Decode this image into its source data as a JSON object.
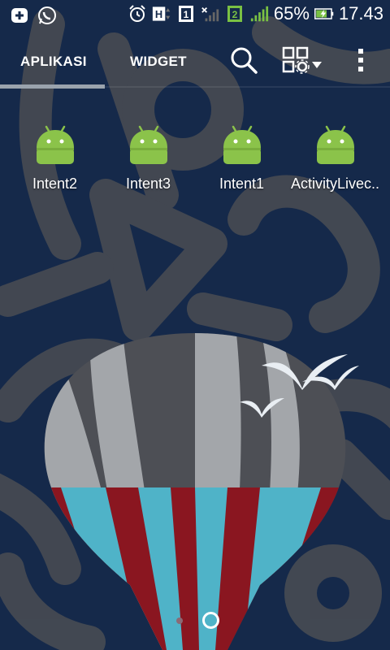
{
  "status_bar": {
    "battery_percent": "65%",
    "time": "17.43",
    "icons": [
      "add-notification-icon",
      "whatsapp-icon",
      "alarm-icon",
      "network-h-icon",
      "sim1-icon",
      "signal-weak-icon",
      "sim2-icon",
      "signal-strong-icon",
      "battery-charging-icon"
    ]
  },
  "tabs": {
    "apps_label": "APLIKASI",
    "widget_label": "WIDGET",
    "selected": "APLIKASI"
  },
  "toolbar": {
    "icons": [
      "search-icon",
      "grid-settings-icon",
      "overflow-menu-icon"
    ]
  },
  "apps": [
    {
      "label": "Intent2",
      "icon": "android-icon"
    },
    {
      "label": "Intent3",
      "icon": "android-icon"
    },
    {
      "label": "Intent1",
      "icon": "android-icon"
    },
    {
      "label": "ActivityLivec..",
      "icon": "android-icon"
    }
  ],
  "page_indicator": {
    "pages": 2,
    "current": "home"
  },
  "colors": {
    "background": "#15294a",
    "android_green": "#8bc34a",
    "balloon_red": "#8a1620",
    "balloon_blue": "#4fb3c8",
    "balloon_gray_light": "#a3a6aa",
    "balloon_gray_dark": "#4d4f55",
    "tab_indicator": "#9aa3ad"
  }
}
